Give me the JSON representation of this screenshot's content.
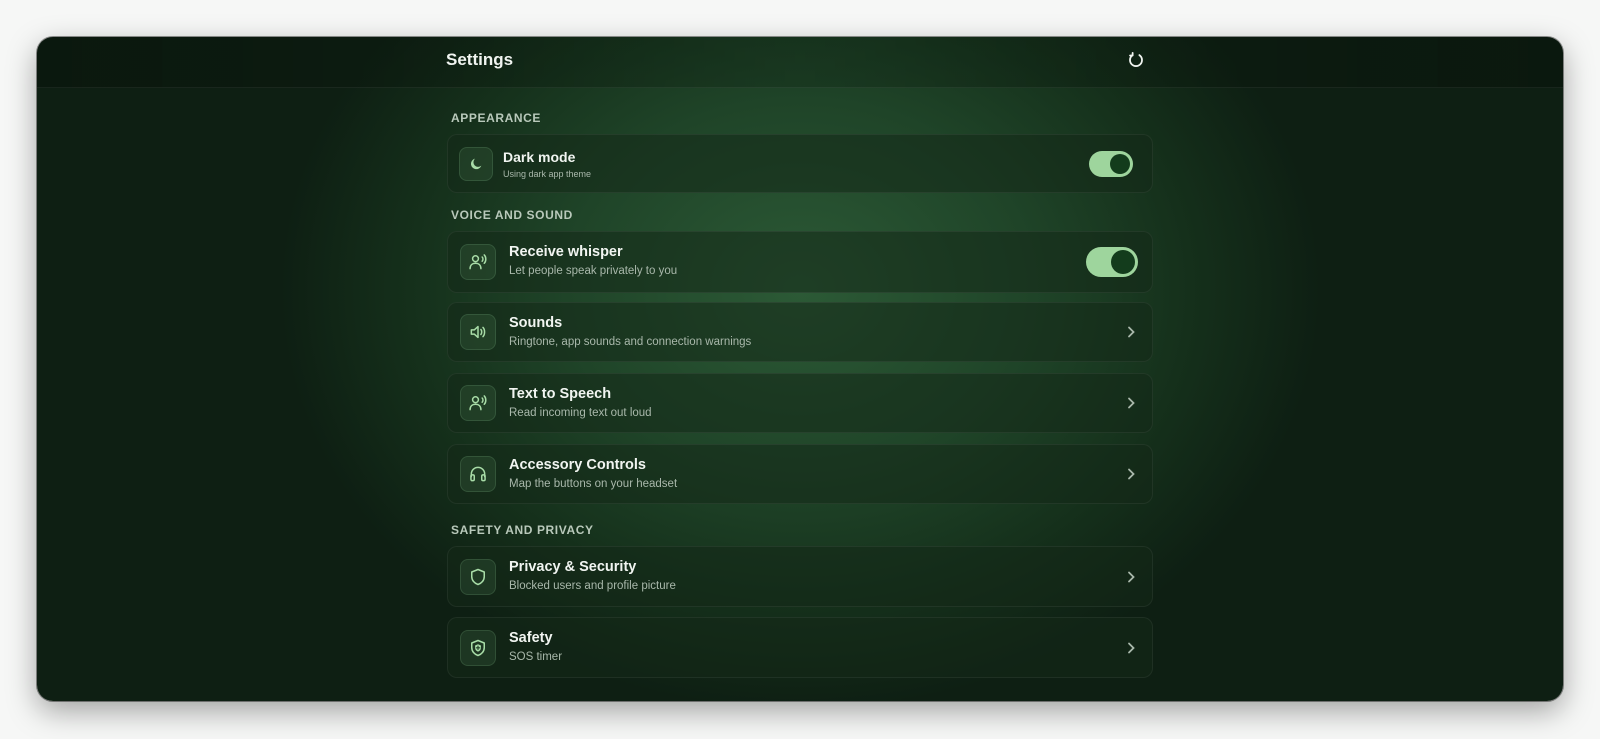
{
  "header": {
    "title": "Settings",
    "refresh_icon": "refresh-icon"
  },
  "sections": {
    "appearance": "APPEARANCE",
    "voice": "VOICE AND SOUND",
    "safety": "SAFETY AND PRIVACY"
  },
  "items": {
    "dark_mode": {
      "title": "Dark mode",
      "subtitle": "Using dark app theme",
      "icon": "moon-icon",
      "enabled": true
    },
    "receive_whisper": {
      "title": "Receive whisper",
      "subtitle": "Let people speak privately to you",
      "icon": "person-voice-icon",
      "enabled": true
    },
    "sounds": {
      "title": "Sounds",
      "subtitle": "Ringtone, app sounds and connection warnings",
      "icon": "speaker-icon"
    },
    "tts": {
      "title": "Text to Speech",
      "subtitle": "Read incoming text out loud",
      "icon": "person-voice-icon"
    },
    "accessory": {
      "title": "Accessory Controls",
      "subtitle": "Map the buttons on your headset",
      "icon": "headset-icon"
    },
    "privacy": {
      "title": "Privacy & Security",
      "subtitle": "Blocked users and profile picture",
      "icon": "shield-icon"
    },
    "safety": {
      "title": "Safety",
      "subtitle": "SOS timer",
      "icon": "shield-plus-icon"
    }
  },
  "colors": {
    "accent": "#9ed59d",
    "knob": "#133c1c",
    "background": "#1f4428"
  }
}
